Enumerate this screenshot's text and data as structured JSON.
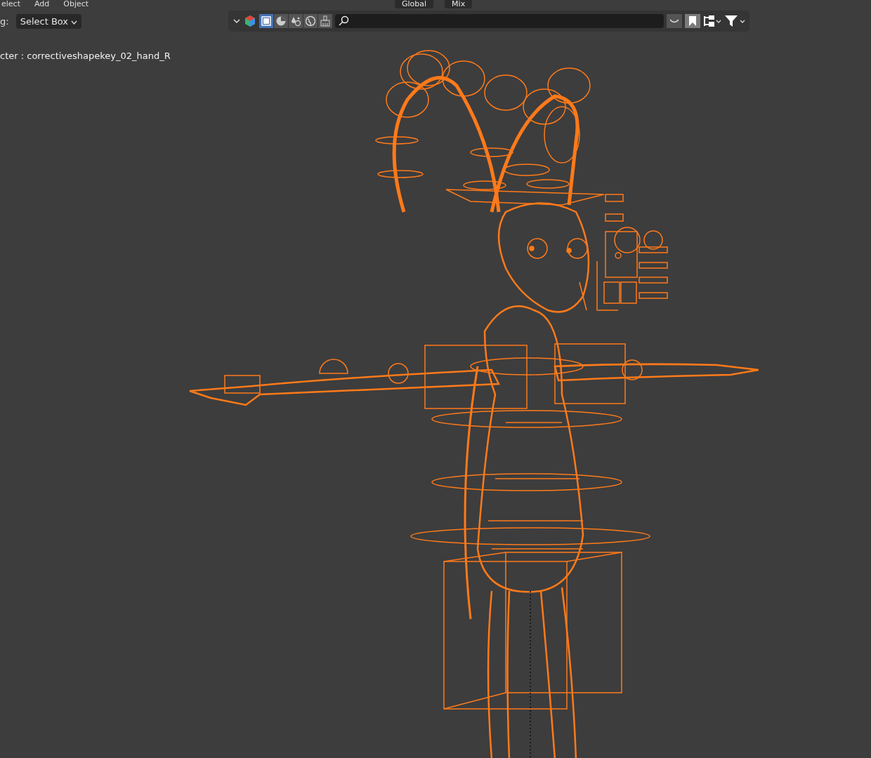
{
  "menu": [
    {
      "label": "elect"
    },
    {
      "label": "Add"
    },
    {
      "label": "Object"
    }
  ],
  "header": {
    "transform_orientation": "Global",
    "shading": "Mix"
  },
  "tool_settings": {
    "drag_label": "g:",
    "select_mode": "Select Box"
  },
  "outliner_filter": {
    "toggles": [
      {
        "kind": "object",
        "selected": true
      },
      {
        "kind": "material",
        "selected": false
      },
      {
        "kind": "light",
        "selected": false
      },
      {
        "kind": "world",
        "selected": false
      },
      {
        "kind": "brush",
        "selected": false
      }
    ],
    "bookmark_on": true
  },
  "viewport": {
    "object_info": "cter : correctiveshapekey_02_hand_R"
  }
}
